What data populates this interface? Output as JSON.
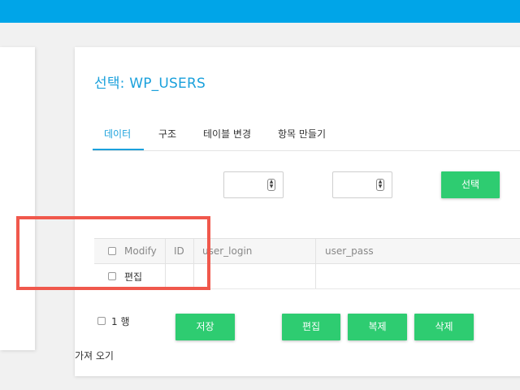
{
  "header": {
    "brand_color": "#00a5e8"
  },
  "page": {
    "title": "선택: WP_USERS"
  },
  "tabs": [
    {
      "label": "데이터",
      "active": true
    },
    {
      "label": "구조",
      "active": false
    },
    {
      "label": "테이블 변경",
      "active": false
    },
    {
      "label": "항목 만들기",
      "active": false
    }
  ],
  "filter": {
    "start_value": "",
    "count_value": "",
    "select_label": "선택"
  },
  "table": {
    "columns": [
      "Modify",
      "ID",
      "user_login",
      "user_pass"
    ],
    "rows": [
      {
        "modify": "편집",
        "id": "",
        "user_login": "",
        "user_pass": ""
      }
    ]
  },
  "footer": {
    "row_count_label": "1 행",
    "import_label": "가져 오기",
    "save_label": "저장",
    "edit_label": "편집",
    "clone_label": "복제",
    "delete_label": "삭제"
  },
  "colors": {
    "accent": "#1ba1dc",
    "button": "#2ecc71",
    "highlight": "#f0584c"
  }
}
